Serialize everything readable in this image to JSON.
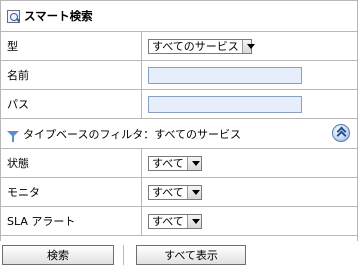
{
  "header": {
    "title": "スマート検索"
  },
  "fields": {
    "type": {
      "label": "型",
      "value": "すべてのサービス"
    },
    "name": {
      "label": "名前",
      "value": ""
    },
    "path": {
      "label": "パス",
      "value": ""
    }
  },
  "filter": {
    "label": "タイプベースのフィルタ：すべてのサービス"
  },
  "filters": {
    "state": {
      "label": "状態",
      "value": "すべて"
    },
    "monitor": {
      "label": "モニタ",
      "value": "すべて"
    },
    "sla": {
      "label": "SLA アラート",
      "value": "すべて"
    }
  },
  "actions": {
    "search_label": "検索",
    "show_all_label": "すべて表示"
  },
  "icons": {
    "title": "search-document-icon",
    "filter": "funnel-icon",
    "collapse": "double-chevron-up-icon",
    "dropdown": "chevron-down-icon"
  },
  "colors": {
    "input_bg": "#e6eefb",
    "border": "#b7b7b7",
    "accent": "#5a8ed0"
  }
}
